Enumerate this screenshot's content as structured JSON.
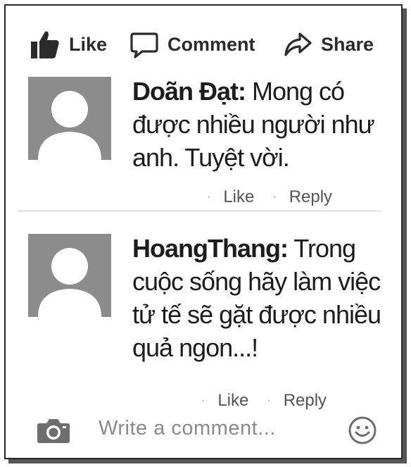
{
  "actions": {
    "like_label": "Like",
    "comment_label": "Comment",
    "share_label": "Share"
  },
  "comments": [
    {
      "author": "Doãn Đạt:",
      "body_lines": [
        " Mong có",
        "được nhiều người như",
        "anh. Tuyệt vời."
      ],
      "like_label": "Like",
      "reply_label": "Reply"
    },
    {
      "author": "HoangThang:",
      "body_lines": [
        " Trong",
        "cuộc sống hãy làm việc",
        "tử tế sẽ gặt được nhiều",
        "quả ngon...!"
      ],
      "like_label": "Like",
      "reply_label": "Reply"
    }
  ],
  "composer": {
    "placeholder": "Write a comment...",
    "camera_icon": "camera-icon",
    "emoji_icon": "emoji-icon"
  },
  "colors": {
    "avatar_bg": "#8c8c8c",
    "text": "#1c1c1c",
    "muted": "#555555"
  }
}
